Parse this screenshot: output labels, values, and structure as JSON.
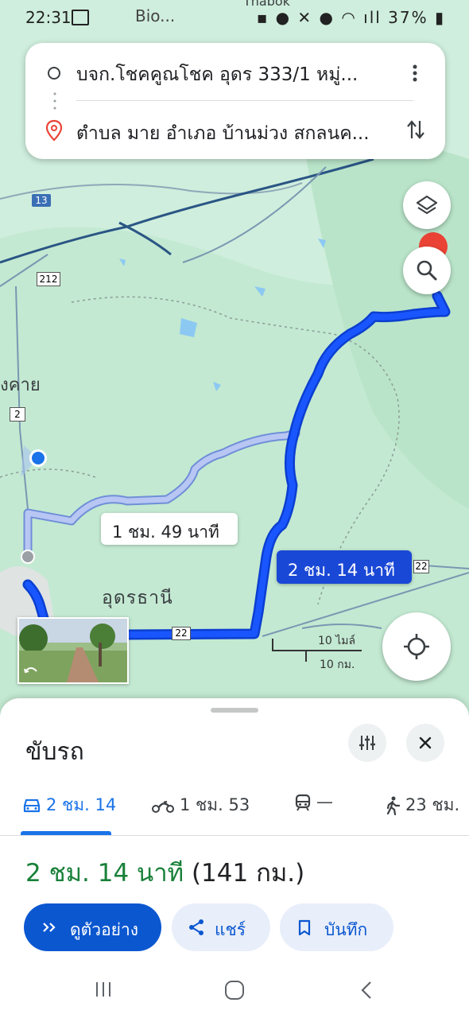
{
  "status_bar": {
    "time": "22:31",
    "app_hint": "Bio...",
    "battery": "37%"
  },
  "search_card": {
    "origin": "บจก.โชคคูณโชค อุดร 333/1 หมู่...",
    "destination": "ตำบล มาย อำเภอ บ้านม่วง สกลนค..."
  },
  "map": {
    "place_label_nongkhai": "งคาย",
    "place_label_udon": "อุดรธานี",
    "place_label_thabok": "Thabok",
    "road_13": "13",
    "road_212": "212",
    "road_2": "2",
    "road_22": "22",
    "road_22_right": "22",
    "route_alt_label": "1 ชม. 49 นาที",
    "route_main_label": "2 ชม. 14 นาที",
    "scale_miles": "10 ไมล์",
    "scale_km": "10 กม.",
    "colors": {
      "route_main": "#1a56ff",
      "route_alt": "#aebdf0",
      "accent": "#1a73e8"
    }
  },
  "sheet": {
    "title": "ขับรถ",
    "tabs": [
      {
        "icon": "car-icon",
        "label": "2 ชม. 14"
      },
      {
        "icon": "motorcycle-icon",
        "label": "1 ชม. 53"
      },
      {
        "icon": "transit-icon",
        "label": "—"
      },
      {
        "icon": "walking-icon",
        "label": "23 ชม."
      }
    ],
    "duration": "2 ชม. 14 นาที",
    "distance": "(141 กม.)",
    "buttons": {
      "preview": "ดูตัวอย่าง",
      "share": "แชร์",
      "save": "บันทึก"
    }
  }
}
